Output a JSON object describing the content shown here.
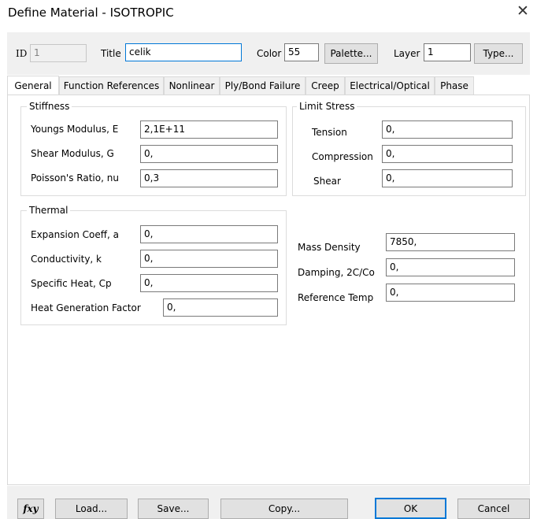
{
  "window": {
    "title": "Define Material - ISOTROPIC"
  },
  "header": {
    "id_label": "ID",
    "id_value": "1",
    "title_label": "Title",
    "title_value": "celik",
    "color_label": "Color",
    "color_value": "55",
    "palette_button": "Palette...",
    "layer_label": "Layer",
    "layer_value": "1",
    "type_button": "Type..."
  },
  "tabs": [
    {
      "label": "General",
      "active": true
    },
    {
      "label": "Function References"
    },
    {
      "label": "Nonlinear"
    },
    {
      "label": "Ply/Bond Failure"
    },
    {
      "label": "Creep"
    },
    {
      "label": "Electrical/Optical"
    },
    {
      "label": "Phase"
    }
  ],
  "stiffness": {
    "title": "Stiffness",
    "youngs_label": "Youngs Modulus, E",
    "youngs_value": "2,1E+11",
    "shear_label": "Shear Modulus, G",
    "shear_value": "0,",
    "poisson_label": "Poisson's Ratio, nu",
    "poisson_value": "0,3"
  },
  "limit_stress": {
    "title": "Limit Stress",
    "tension_label": "Tension",
    "tension_value": "0,",
    "compression_label": "Compression",
    "compression_value": "0,",
    "shear_label": "Shear",
    "shear_value": "0,"
  },
  "thermal": {
    "title": "Thermal",
    "expansion_label": "Expansion Coeff, a",
    "expansion_value": "0,",
    "conductivity_label": "Conductivity, k",
    "conductivity_value": "0,",
    "specific_heat_label": "Specific Heat, Cp",
    "specific_heat_value": "0,",
    "heat_gen_label": "Heat Generation Factor",
    "heat_gen_value": "0,"
  },
  "other": {
    "mass_density_label": "Mass Density",
    "mass_density_value": "7850,",
    "damping_label": "Damping, 2C/Co",
    "damping_value": "0,",
    "ref_temp_label": "Reference Temp",
    "ref_temp_value": "0,"
  },
  "footer": {
    "fxy_label": "fxy",
    "load_button": "Load...",
    "save_button": "Save...",
    "copy_button": "Copy...",
    "ok_button": "OK",
    "cancel_button": "Cancel"
  }
}
